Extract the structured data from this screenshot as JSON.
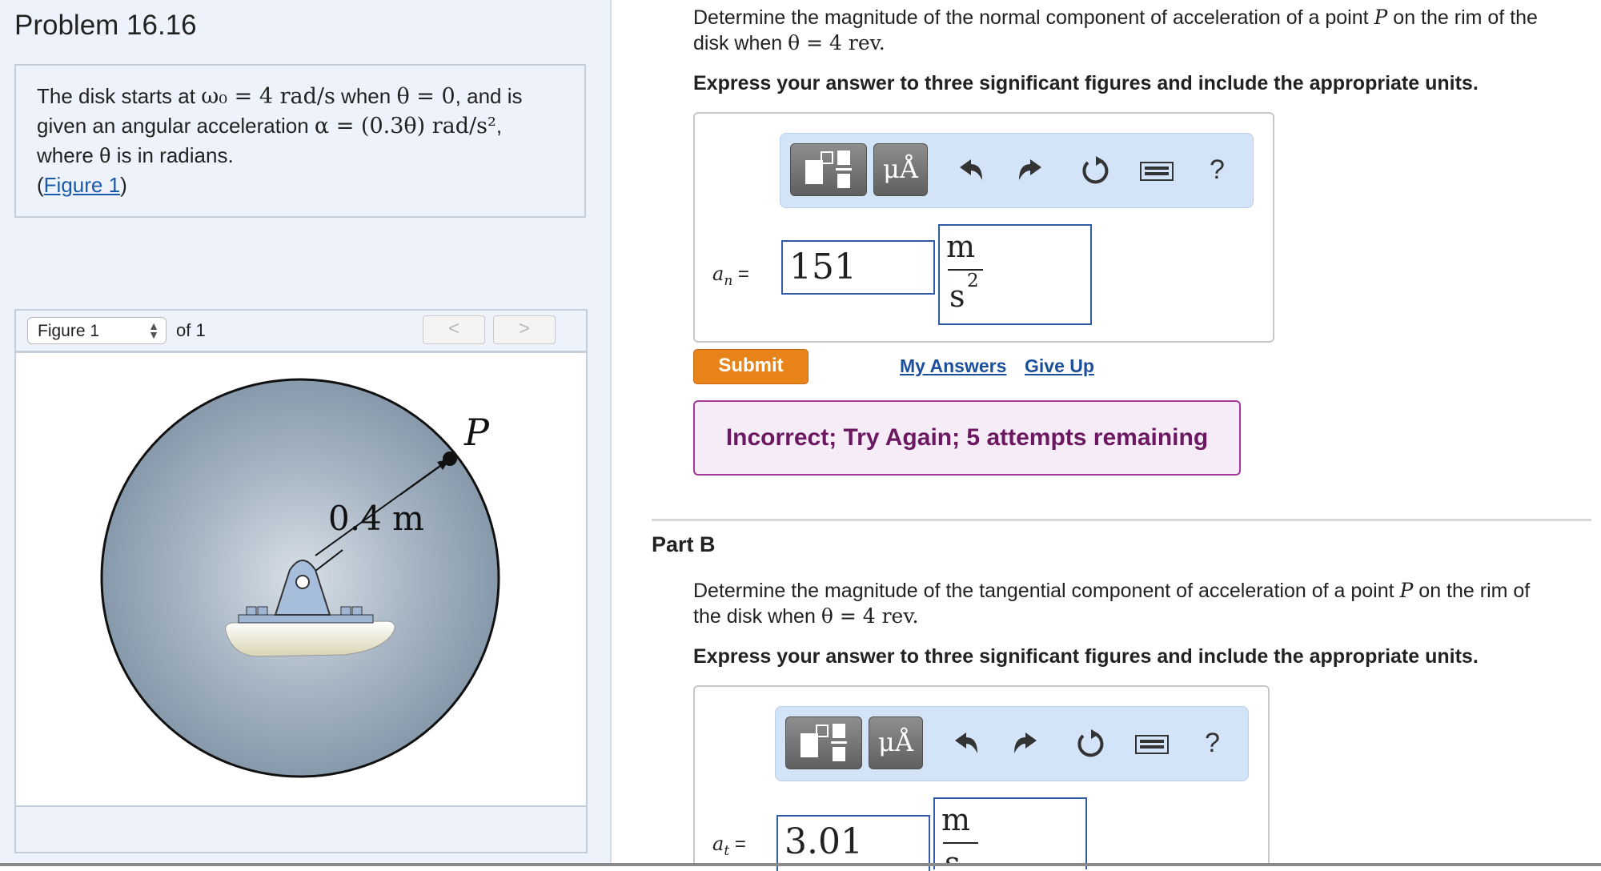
{
  "problem": {
    "title": "Problem 16.16",
    "statement": {
      "line1_pre": "The disk starts at ",
      "omega0": "ω₀ = 4 rad/s",
      "line1_mid": " when ",
      "theta0": "θ = 0",
      "line1_post": ", and is",
      "line2_pre": "given an angular acceleration ",
      "alpha": "α = (0.3θ) rad/s²",
      "line2_post": ",",
      "line3": "where θ is in radians.",
      "figure_link_open": "(",
      "figure_link": "Figure 1",
      "figure_link_close": ")"
    }
  },
  "figure": {
    "selector_value": "Figure 1",
    "of_label": "of 1",
    "prev_label": "<",
    "next_label": ">",
    "radius_label": "0.4 m",
    "point_label": "P"
  },
  "part_a": {
    "question_pre": "Determine the magnitude of the normal component of acceleration of a point ",
    "question_point": "P",
    "question_mid": " on the rim of the",
    "question_line2": "disk when ",
    "question_math": "θ = 4 rev.",
    "instructions": "Express your answer to three significant figures and include the appropriate units.",
    "toolbar": {
      "units_btn": "μÅ",
      "help": "?"
    },
    "var_label_main": "a",
    "var_label_sub": "n",
    "var_label_eq": " =",
    "value": "151",
    "units": {
      "num": "m",
      "den": "s",
      "exp": "2"
    },
    "submit": "Submit",
    "my_answers": "My Answers",
    "give_up": "Give Up",
    "feedback": "Incorrect; Try Again; 5 attempts remaining"
  },
  "part_b": {
    "title": "Part B",
    "question_pre": "Determine the magnitude of the tangential component of acceleration of a point ",
    "question_point": "P",
    "question_mid": " on the rim of",
    "question_line2": "the disk when ",
    "question_math": "θ = 4 rev.",
    "instructions": "Express your answer to three significant figures and include the appropriate units.",
    "toolbar": {
      "units_btn": "μÅ",
      "help": "?"
    },
    "var_label_main": "a",
    "var_label_sub": "t",
    "var_label_eq": " =",
    "value": "3.01",
    "units": {
      "num": "m",
      "den": "s"
    }
  },
  "colors": {
    "panel_bg": "#eef3fb",
    "toolbar_bg": "#d3e3f8",
    "input_border": "#2f5da8",
    "submit": "#e88319",
    "feedback_border": "#a6379b",
    "link": "#1b4f9b"
  },
  "icons": [
    "template-icon",
    "undo-icon",
    "redo-icon",
    "reset-icon",
    "keyboard-icon",
    "help-icon"
  ]
}
